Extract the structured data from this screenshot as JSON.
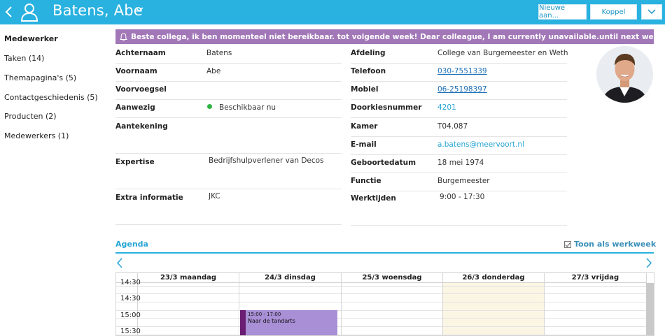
{
  "header": {
    "title": "Batens, Abe",
    "new_button": "Nieuwe aan...",
    "koppel_button": "Koppel",
    "colors": {
      "bar": "#29b1e0"
    }
  },
  "sidebar": {
    "items": [
      {
        "label": "Medewerker",
        "active": true
      },
      {
        "label": "Taken (14)"
      },
      {
        "label": "Themapagina's (5)"
      },
      {
        "label": "Contactgeschiedenis (5)"
      },
      {
        "label": "Producten (2)"
      },
      {
        "label": "Medewerkers (1)"
      }
    ]
  },
  "banner": {
    "text": "Beste collega, ik ben momenteel niet bereikbaar. tot volgende week! Dear colleague, I am currently unavailable.until next week!",
    "color": "#a277b7"
  },
  "details_left": [
    {
      "label": "Achternaam",
      "value": "Batens"
    },
    {
      "label": "Voornaam",
      "value": "Abe"
    },
    {
      "label": "Voorvoegsel",
      "value": ""
    },
    {
      "label": "Aanwezig",
      "value": "Beschikbaar nu"
    },
    {
      "label": "Aantekening",
      "value": ""
    },
    {
      "label": "Expertise",
      "value": "Bedrijfshulpverlener van Decos"
    },
    {
      "label": "Extra informatie",
      "value": "JKC"
    }
  ],
  "details_right": [
    {
      "label": "Afdeling",
      "value": "College van Burgemeester en Wethou..."
    },
    {
      "label": "Telefoon",
      "value": "030-7551339"
    },
    {
      "label": "Mobiel",
      "value": "06-25198397"
    },
    {
      "label": "Doorkiesnummer",
      "value": "4201"
    },
    {
      "label": "Kamer",
      "value": "T04.087"
    },
    {
      "label": "E-mail",
      "value": "a.batens@meervoort.nl"
    },
    {
      "label": "Geboortedatum",
      "value": "18 mei 1974"
    },
    {
      "label": "Functie",
      "value": "Burgemeester"
    },
    {
      "label": "Werktijden",
      "value": "9:00 - 17:30"
    }
  ],
  "agenda": {
    "tab_label": "Agenda",
    "werkweek_label": "Toon als werkweek",
    "days": [
      "23/3 maandag",
      "24/3 dinsdag",
      "25/3 woensdag",
      "26/3 donderdag",
      "27/3 vrijdag"
    ],
    "times": [
      "14:30",
      "15:00",
      "15:30"
    ],
    "event": {
      "time": "15:00 - 17:00",
      "title": "Naar de tandarts",
      "color": "#a98fd6",
      "bar_color": "#6a1d72"
    }
  }
}
